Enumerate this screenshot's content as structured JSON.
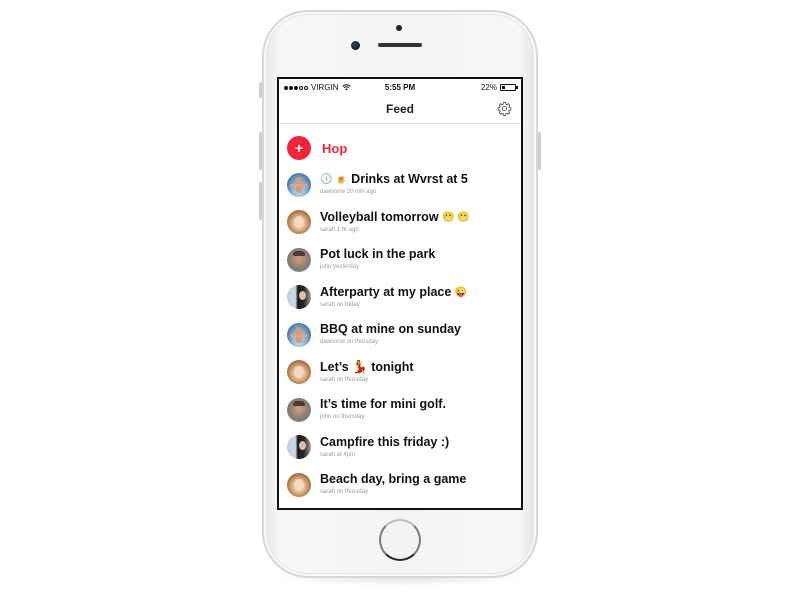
{
  "device": {
    "model": "iPhone",
    "color": "silver"
  },
  "status_bar": {
    "carrier": "VIRGIN",
    "signal_bars_on": 3,
    "signal_bars_total": 5,
    "time": "5:55 PM",
    "battery_percent": "22%",
    "battery_level": 0.22
  },
  "nav": {
    "title": "Feed",
    "settings_icon": "gear-icon"
  },
  "colors": {
    "accent": "#f0253b",
    "title_text": "#111111",
    "meta_text": "#9a9a9a"
  },
  "hop": {
    "icon": "+",
    "label": "Hop"
  },
  "feed": [
    {
      "emoji_prefix": "🕔 🍺",
      "title": "Drinks at Wvrst at 5",
      "emoji_suffix": "",
      "user": "dawsonw",
      "when": "20 min ago",
      "meta": "dawsonw 20 min ago",
      "avatar": "dawsonw"
    },
    {
      "emoji_prefix": "",
      "title": "Volleyball tomorrow",
      "emoji_suffix": "😬 😬",
      "user": "sarah",
      "when": "1 hr ago",
      "meta": "sarah 1 hr ago",
      "avatar": "sarah-blonde"
    },
    {
      "emoji_prefix": "",
      "title": "Pot luck in the park",
      "emoji_suffix": "",
      "user": "john",
      "when": "yesterday",
      "meta": "john yesterday",
      "avatar": "john"
    },
    {
      "emoji_prefix": "",
      "title": "Afterparty at my place",
      "emoji_suffix": "😜",
      "user": "sarah",
      "when": "on friday",
      "meta": "sarah on friday",
      "avatar": "sarah-dark"
    },
    {
      "emoji_prefix": "",
      "title": "BBQ at mine on sunday",
      "emoji_suffix": "",
      "user": "dawsonw",
      "when": "on thursday",
      "meta": "dawsonw on thursday",
      "avatar": "dawsonw"
    },
    {
      "emoji_prefix": "",
      "title": "Let’s 💃 tonight",
      "emoji_suffix": "",
      "user": "sarah",
      "when": "on thursday",
      "meta": "sarah on thursday",
      "avatar": "sarah-blonde"
    },
    {
      "emoji_prefix": "",
      "title": "It’s time for mini golf.",
      "emoji_suffix": "",
      "user": "john",
      "when": "on thursday",
      "meta": "john on thursday",
      "avatar": "john"
    },
    {
      "emoji_prefix": "",
      "title": "Campfire this friday :)",
      "emoji_suffix": "",
      "user": "sarah",
      "when": "at 4pm",
      "meta": "sarah at 4pm",
      "avatar": "sarah-dark"
    },
    {
      "emoji_prefix": "",
      "title": "Beach day, bring a game",
      "emoji_suffix": "",
      "user": "sarah",
      "when": "on thursday",
      "meta": "sarah on thursday",
      "avatar": "sarah-blonde"
    }
  ]
}
